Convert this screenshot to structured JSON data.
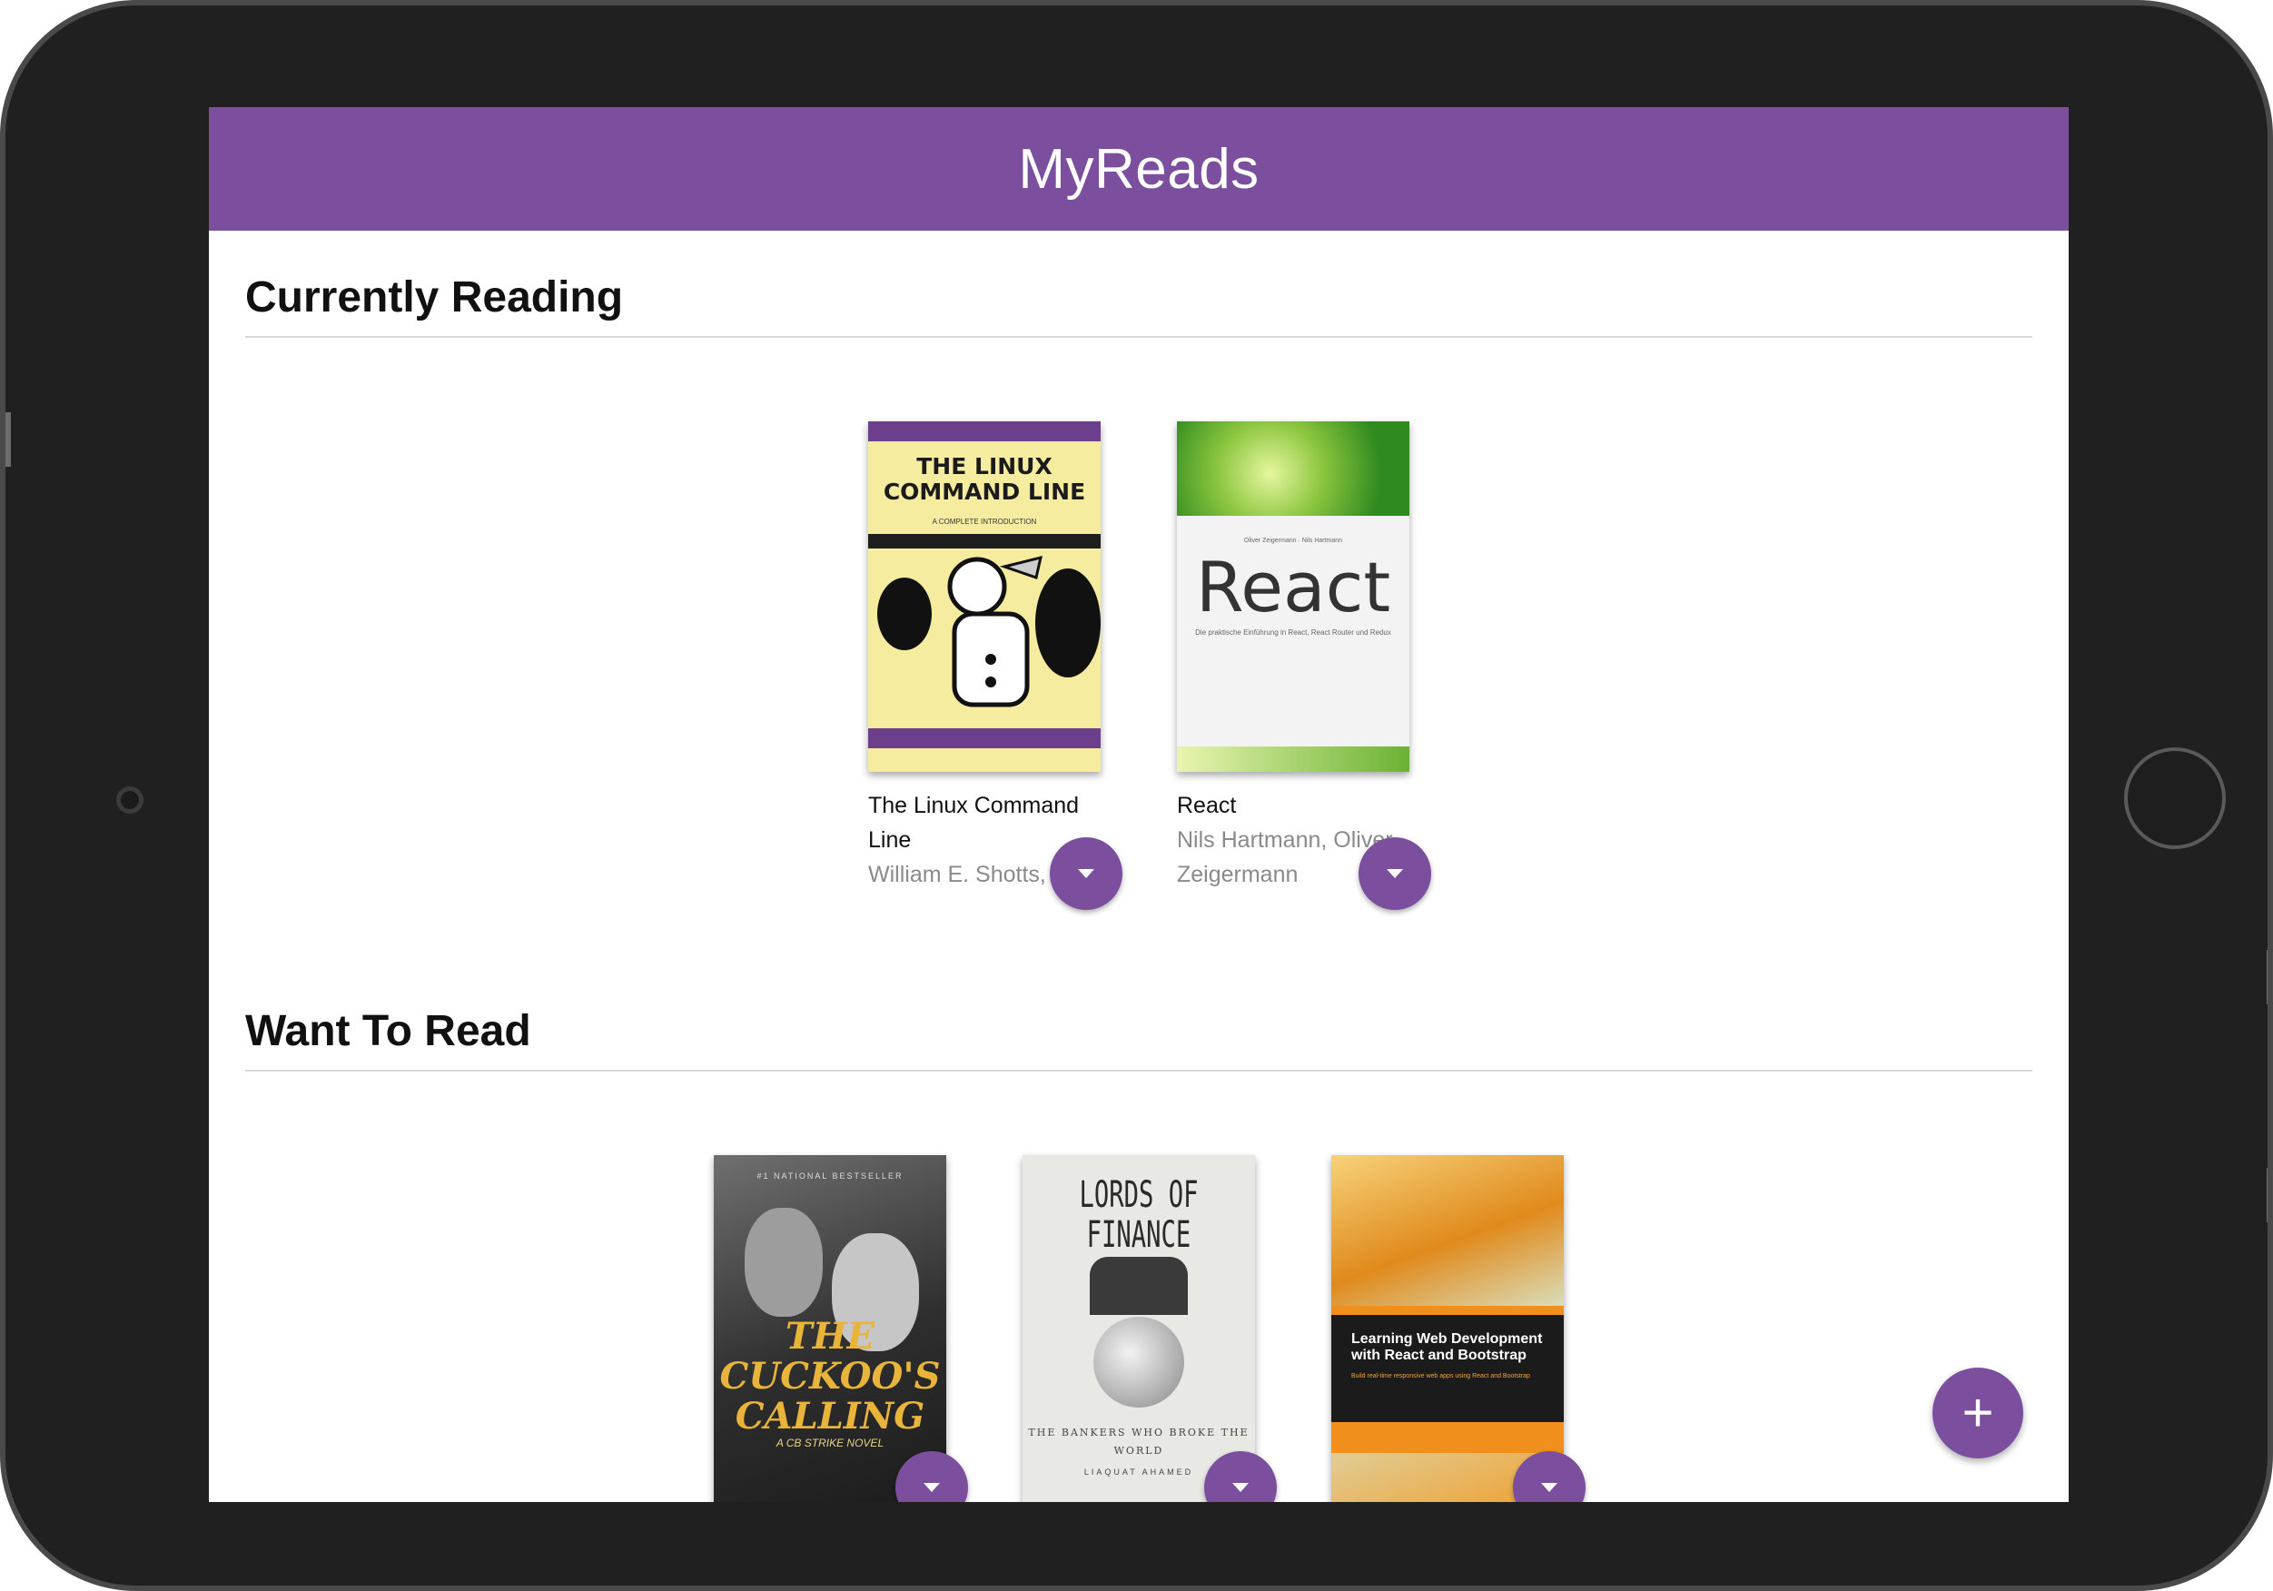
{
  "app": {
    "title": "MyReads"
  },
  "shelves": [
    {
      "title": "Currently Reading",
      "books": [
        {
          "title": "The Linux Command Line",
          "authors": "William E. Shotts, Jr.",
          "cover": {
            "main_text": "THE LINUX COMMAND LINE",
            "sub_text": "A COMPLETE INTRODUCTION"
          }
        },
        {
          "title": "React",
          "authors": "Nils Hartmann, Oliver Zeigermann",
          "cover": {
            "authors_text": "Oliver Zeigermann · Nils Hartmann",
            "main_text": "React",
            "sub_text": "Die praktische Einführung in React, React Router und Redux"
          }
        }
      ]
    },
    {
      "title": "Want To Read",
      "books": [
        {
          "cover": {
            "top_text": "#1 NATIONAL BESTSELLER",
            "main_text": "THE CUCKOO'S CALLING",
            "sub_text": "A CB STRIKE NOVEL"
          }
        },
        {
          "cover": {
            "main_text": "LORDS OF FINANCE",
            "sub_text": "THE BANKERS WHO BROKE THE WORLD",
            "author_text": "LIAQUAT AHAMED"
          }
        },
        {
          "cover": {
            "main_text": "Learning Web Development with React and Bootstrap",
            "sub_text": "Build real-time responsive web apps using React and Bootstrap"
          }
        }
      ]
    }
  ],
  "add_button": {
    "icon": "plus-icon",
    "label": "+"
  },
  "colors": {
    "accent": "#7b4f9e",
    "device_frame": "#202020"
  }
}
